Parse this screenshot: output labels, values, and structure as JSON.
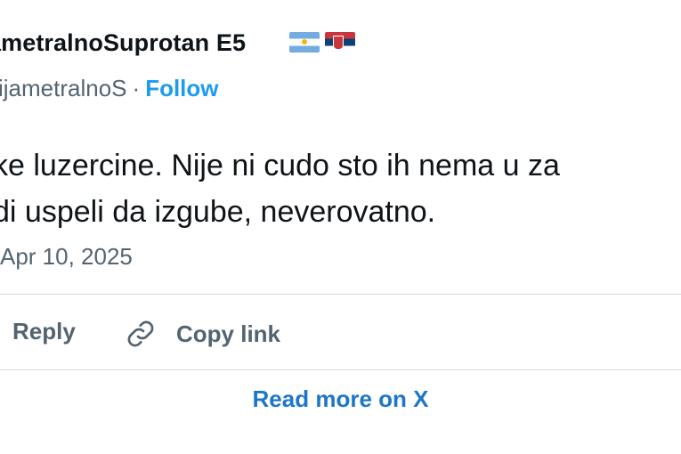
{
  "author": {
    "display_name": "ametralnoSuprotan E5",
    "handle": "ijametralnoS",
    "separator": "·",
    "follow_label": "Follow",
    "flags": [
      "argentina-flag-icon",
      "serbia-flag-icon"
    ]
  },
  "tweet": {
    "line1": "ke luzercine. Nije ni cudo sto ih nema u za",
    "line2": "di uspeli da izgube, neverovatno.",
    "timestamp": "Apr 10, 2025"
  },
  "actions": {
    "reply_label": "Reply",
    "copy_link_label": "Copy link"
  },
  "footer": {
    "read_more_label": "Read more on X"
  },
  "colors": {
    "link": "#1d9bf0",
    "read_more": "#1d77c9",
    "muted": "#536471",
    "divider": "#cfd9de"
  }
}
